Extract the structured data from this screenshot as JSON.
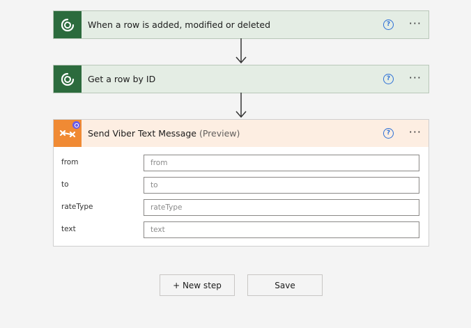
{
  "steps": [
    {
      "title": "When a row is added, modified or deleted",
      "icon": "dataverse-icon",
      "color": "#2c6b3d"
    },
    {
      "title": "Get a row by ID",
      "icon": "dataverse-icon",
      "color": "#2c6b3d"
    }
  ],
  "viber": {
    "title": "Send Viber Text Message",
    "subtitle": "(Preview)",
    "icon": "viber-connector-icon",
    "color": "#f08a34",
    "fields": [
      {
        "label": "from",
        "placeholder": "from",
        "value": ""
      },
      {
        "label": "to",
        "placeholder": "to",
        "value": ""
      },
      {
        "label": "rateType",
        "placeholder": "rateType",
        "value": ""
      },
      {
        "label": "text",
        "placeholder": "text",
        "value": ""
      }
    ]
  },
  "help_glyph": "?",
  "more_glyph": "···",
  "buttons": {
    "new_step": "+ New step",
    "save": "Save"
  }
}
